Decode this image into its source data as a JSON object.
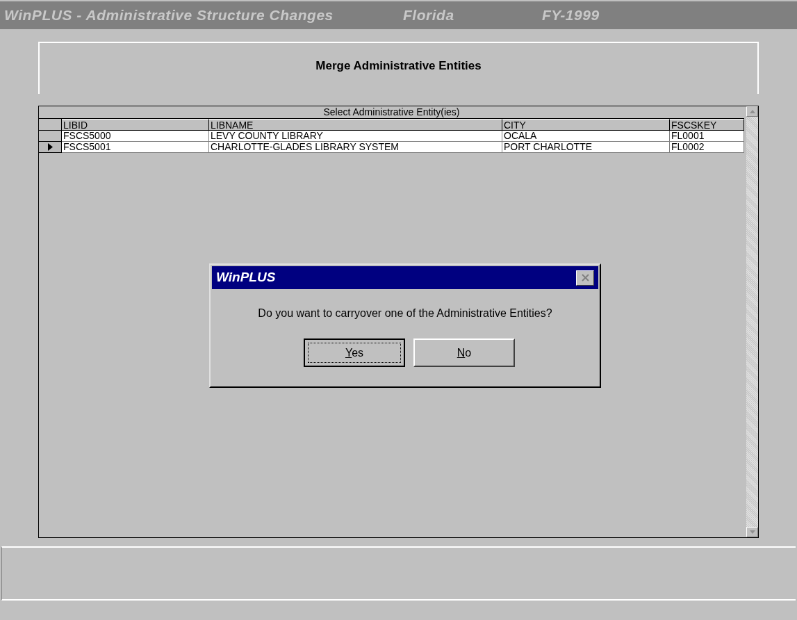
{
  "window": {
    "title": "WinPLUS - Administrative Structure Changes",
    "state": "Florida",
    "fiscal_year": "FY-1999"
  },
  "header": {
    "title": "Merge Administrative Entities"
  },
  "grid": {
    "caption": "Select Administrative Entity(ies)",
    "columns": [
      "LIBID",
      "LIBNAME",
      "CITY",
      "FSCSKEY"
    ],
    "rows": [
      {
        "cells": [
          "FSCS5000",
          "LEVY COUNTY LIBRARY",
          "OCALA",
          "FL0001"
        ],
        "selected": false
      },
      {
        "cells": [
          "FSCS5001",
          "CHARLOTTE-GLADES LIBRARY SYSTEM",
          "PORT CHARLOTTE",
          "FL0002"
        ],
        "selected": true
      }
    ]
  },
  "dialog": {
    "title": "WinPLUS",
    "message": "Do you want to carryover one of the Administrative Entities?",
    "buttons": [
      {
        "label": "Yes",
        "default": true
      },
      {
        "label": "No",
        "default": false
      }
    ]
  }
}
